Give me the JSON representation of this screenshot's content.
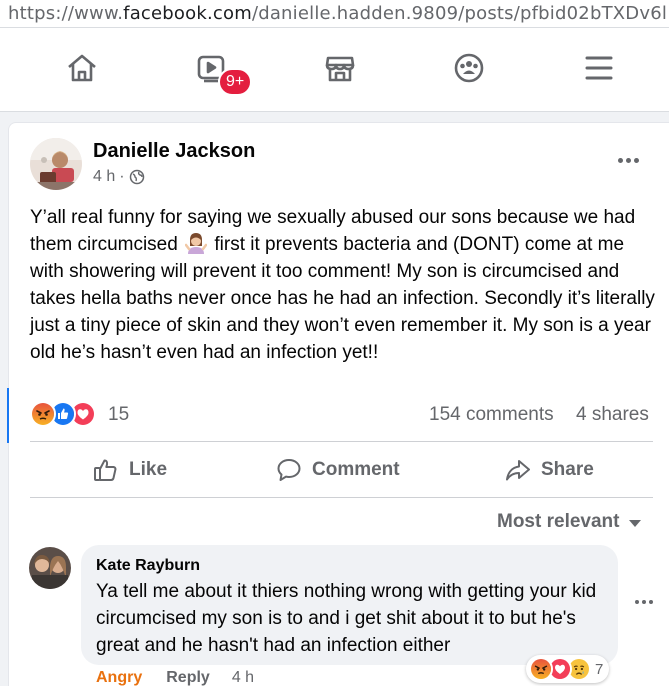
{
  "browser": {
    "url_prefix": "https://www.",
    "url_domain": "facebook.com",
    "url_rest": "/danielle.hadden.9809/posts/pfbid02bTXDv6l"
  },
  "nav": {
    "items": [
      "home-icon",
      "video-icon",
      "marketplace-icon",
      "groups-icon",
      "menu-icon"
    ],
    "video_badge": "9+",
    "badge_color": "#e41e3f"
  },
  "post": {
    "author": "Danielle Jackson",
    "time": "4 h",
    "separator": "·",
    "privacy_icon": "globe-icon",
    "text_part1": "Y’all real funny for saying we sexually abused our sons because we had them circumcised",
    "text_emoji": "woman-shrugging-emoji",
    "text_part2": "first it prevents bacteria and (DONT) come at me with showering will prevent it too comment! My son is circumcised and takes hella baths never once has he had an infection. Secondly it’s literally just a tiny piece of skin and they won’t even remember it. My son is a year old he’s hasn’t even had an infection yet!!",
    "reactions": [
      "angry",
      "like",
      "love"
    ],
    "reaction_count": "15",
    "comments_count": "154 comments",
    "shares_count": "4 shares"
  },
  "actions": {
    "like": "Like",
    "comment": "Comment",
    "share": "Share"
  },
  "sort": {
    "label": "Most relevant"
  },
  "comment": {
    "author": "Kate Rayburn",
    "text": "Ya tell me about it thiers nothing wrong with getting your kid circumcised my son is to and i get shit about it to but he's great and he hasn't had an infection either",
    "reactions": [
      "angry",
      "love",
      "sad"
    ],
    "reaction_count": "7",
    "angry_label": "Angry",
    "reply_label": "Reply",
    "time": "4 h"
  },
  "colors": {
    "facebook_blue": "#1877f2",
    "angry": "#e9710f",
    "secondary_text": "#65676b",
    "feed_bg": "#f0f2f5"
  }
}
